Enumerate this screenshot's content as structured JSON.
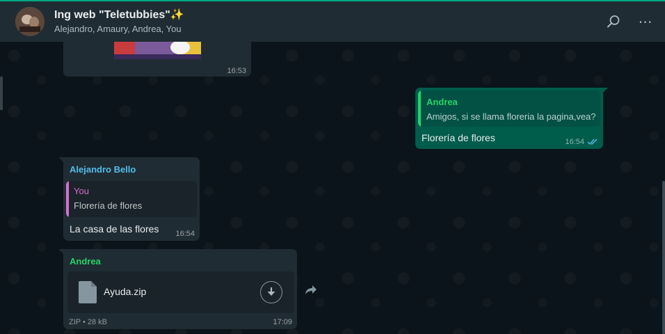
{
  "header": {
    "title": "Ing web \"Teletubbies\"✨",
    "participants": "Alejandro, Amaury, Andrea, You",
    "search_icon": "search-icon",
    "menu_icon": "more-options-icon",
    "menu_glyph": "⋯"
  },
  "messages": [
    {
      "id": "m1",
      "type": "image",
      "direction": "incoming",
      "time": "16:53"
    },
    {
      "id": "m2",
      "direction": "outgoing",
      "quote": {
        "author": "Andrea",
        "text": "Amigos, si se llama floreria la pagina,vea?"
      },
      "text": "Florería de flores",
      "time": "16:54",
      "status": "read"
    },
    {
      "id": "m3",
      "direction": "incoming",
      "sender": "Alejandro Bello",
      "quote": {
        "author": "You",
        "text": "Florería de flores"
      },
      "text": "La casa de las flores",
      "time": "16:54"
    },
    {
      "id": "m4",
      "direction": "incoming",
      "sender": "Andrea",
      "file": {
        "name": "Ayuda.zip",
        "meta": "ZIP • 28 kB"
      },
      "time": "17:09"
    }
  ],
  "colors": {
    "accent": "#00a884",
    "sender_alejandro": "#53bdeb",
    "sender_andrea": "#25d366",
    "quote_you": "#d86ecf",
    "read_ticks": "#53bdeb"
  }
}
